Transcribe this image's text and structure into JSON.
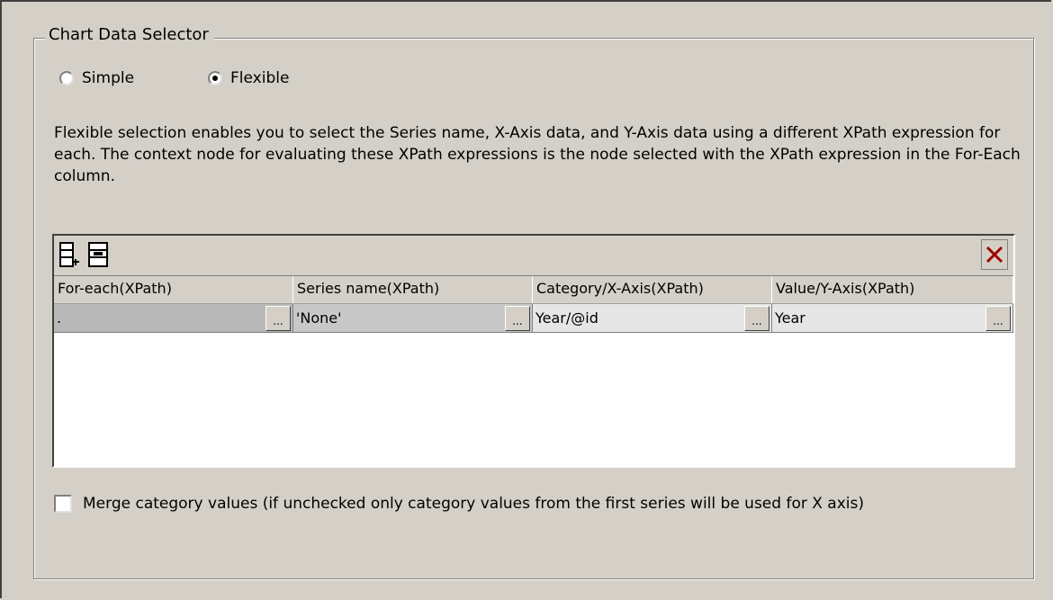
{
  "group": {
    "title": "Chart Data Selector"
  },
  "mode": {
    "options": [
      {
        "label": "Simple",
        "selected": false
      },
      {
        "label": "Flexible",
        "selected": true
      }
    ]
  },
  "description": "Flexible selection enables you to select the Series name, X-Axis data, and Y-Axis data using a different XPath expression for each. The context node for evaluating these XPath expressions is the node selected with the XPath expression in the For-Each column.",
  "grid": {
    "toolbar": {
      "insert_row_icon": "insert-row-icon",
      "append_row_icon": "append-row-icon",
      "delete_icon": "delete-icon"
    },
    "columns": [
      "For-each(XPath)",
      "Series name(XPath)",
      "Category/X-Axis(XPath)",
      "Value/Y-Axis(XPath)"
    ],
    "rows": [
      [
        ".",
        "'None'",
        "Year/@id",
        "Year"
      ]
    ],
    "ellipsis": "..."
  },
  "merge": {
    "label": "Merge category values (if unchecked only category values from the first series will be used for X axis)",
    "checked": false
  }
}
